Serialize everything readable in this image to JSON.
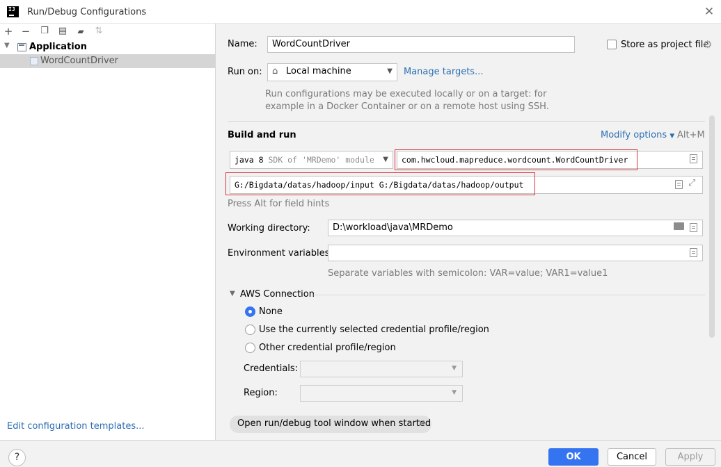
{
  "window": {
    "title": "Run/Debug Configurations",
    "logo_text": "IJ",
    "close_glyph": "✕"
  },
  "toolbar": {
    "icons": [
      "plus-icon",
      "minus-icon",
      "copy-icon",
      "save-icon",
      "folder-add-icon",
      "sort-icon"
    ],
    "glyphs": {
      "add": "+",
      "remove": "−",
      "copy": "❐",
      "save": "▤",
      "folder": "▰",
      "sort": "⇅"
    }
  },
  "tree": {
    "root_label": "Application",
    "root_arrow": "▼",
    "child_label": "WordCountDriver"
  },
  "edit_templates_link": "Edit configuration templates...",
  "form": {
    "name_label": "Name:",
    "name_value": "WordCountDriver",
    "store_label": "Store as project file",
    "run_on_label": "Run on:",
    "run_on_value": "Local machine",
    "manage_targets": "Manage targets...",
    "run_on_hint_1": "Run configurations may be executed locally or on a target: for",
    "run_on_hint_2": "example in a Docker Container or on a remote host using SSH.",
    "build_run_title": "Build and run",
    "modify_options": "Modify options",
    "modify_shortcut": "Alt+M",
    "jdk_prefix": "java 8",
    "jdk_suffix": "SDK of 'MRDemo' module",
    "main_class": "com.hwcloud.mapreduce.wordcount.WordCountDriver",
    "program_args": "G:/Bigdata/datas/hadoop/input G:/Bigdata/datas/hadoop/output",
    "field_hints": "Press Alt for field hints",
    "working_dir_label": "Working directory:",
    "working_dir_value": "D:\\workload\\java\\MRDemo",
    "env_vars_label": "Environment variables:",
    "env_vars_value": "",
    "env_hint": "Separate variables with semicolon: VAR=value; VAR1=value1",
    "aws_title": "AWS Connection",
    "aws_options": [
      "None",
      "Use the currently selected credential profile/region",
      "Other credential profile/region"
    ],
    "aws_selected": "None",
    "credentials_label": "Credentials:",
    "region_label": "Region:",
    "tool_window_chip": "Open run/debug tool window when started",
    "chip_close": "×"
  },
  "buttons": {
    "help": "?",
    "ok": "OK",
    "cancel": "Cancel",
    "apply": "Apply"
  }
}
